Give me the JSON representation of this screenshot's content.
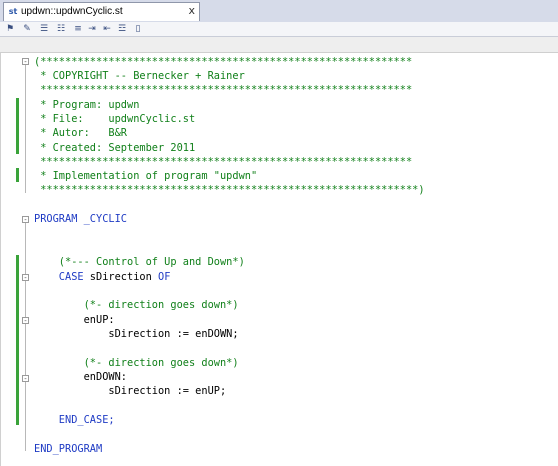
{
  "tab": {
    "label": "updwn::updwnCyclic.st",
    "close_symbol": "x",
    "icon": "st-file-icon"
  },
  "toolbar": {
    "buttons": [
      "toolbar-btn-1",
      "toolbar-btn-2",
      "toolbar-btn-3",
      "toolbar-btn-4",
      "toolbar-btn-5",
      "toolbar-btn-6",
      "toolbar-btn-7",
      "toolbar-btn-8",
      "toolbar-btn-9"
    ]
  },
  "code": {
    "l1": "(************************************************************",
    "l2": " * COPYRIGHT -- Bernecker + Rainer",
    "l3": " ************************************************************",
    "l4": " * Program: updwn",
    "l5": " * File:    updwnCyclic.st",
    "l6": " * Autor:   B&R",
    "l7": " * Created: September 2011",
    "l8": " ************************************************************",
    "l9": " * Implementation of program \"updwn\"",
    "l10": " *************************************************************)",
    "l12": "PROGRAM _CYCLIC",
    "l15": "    (*--- Control of Up and Down*)",
    "l16_kw1": "    CASE",
    "l16_txt": " sDirection ",
    "l16_kw2": "OF",
    "l18": "        (*- direction goes down*)",
    "l19": "        enUP:",
    "l20": "            sDirection := enDOWN;",
    "l22": "        (*- direction goes down*)",
    "l23": "        enDOWN:",
    "l24": "            sDirection := enUP;",
    "l26": "    END_CASE;",
    "l28": "END_PROGRAM"
  },
  "colors": {
    "comment": "#11801a",
    "keyword": "#1f3bc4",
    "change_bar": "#3aa33a"
  }
}
